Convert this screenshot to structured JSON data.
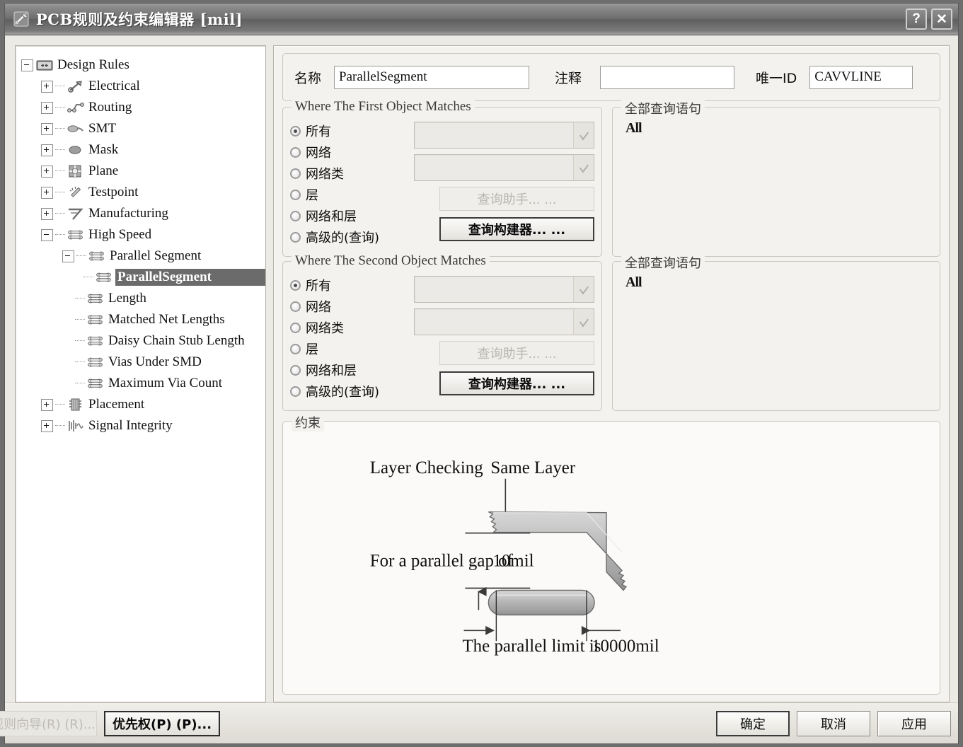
{
  "window": {
    "title": "PCB规则及约束编辑器 [mil]",
    "help_button": "?",
    "close_button": "✕"
  },
  "tree": {
    "root": {
      "label": "Design Rules",
      "icon": "design-rules-icon",
      "expanded": true
    },
    "items": [
      {
        "label": "Electrical",
        "icon": "electrical-icon",
        "expanded": false,
        "depth": 1
      },
      {
        "label": "Routing",
        "icon": "routing-icon",
        "expanded": false,
        "depth": 1
      },
      {
        "label": "SMT",
        "icon": "smt-icon",
        "expanded": false,
        "depth": 1
      },
      {
        "label": "Mask",
        "icon": "mask-icon",
        "expanded": false,
        "depth": 1
      },
      {
        "label": "Plane",
        "icon": "plane-icon",
        "expanded": false,
        "depth": 1
      },
      {
        "label": "Testpoint",
        "icon": "testpoint-icon",
        "expanded": false,
        "depth": 1
      },
      {
        "label": "Manufacturing",
        "icon": "manufacturing-icon",
        "expanded": false,
        "depth": 1
      },
      {
        "label": "High Speed",
        "icon": "highspeed-icon",
        "expanded": true,
        "depth": 1
      },
      {
        "label": "Parallel Segment",
        "icon": "highspeed-icon",
        "expanded": true,
        "depth": 2
      },
      {
        "label": "ParallelSegment",
        "icon": "highspeed-icon",
        "selected": true,
        "depth": 3
      },
      {
        "label": "Length",
        "icon": "highspeed-icon",
        "depth": 2
      },
      {
        "label": "Matched Net Lengths",
        "icon": "highspeed-icon",
        "depth": 2
      },
      {
        "label": "Daisy Chain Stub Length",
        "icon": "highspeed-icon",
        "depth": 2
      },
      {
        "label": "Vias Under SMD",
        "icon": "highspeed-icon",
        "depth": 2
      },
      {
        "label": "Maximum Via Count",
        "icon": "highspeed-icon",
        "depth": 2
      },
      {
        "label": "Placement",
        "icon": "placement-icon",
        "expanded": false,
        "depth": 1
      },
      {
        "label": "Signal Integrity",
        "icon": "signal-integrity-icon",
        "expanded": false,
        "depth": 1
      }
    ]
  },
  "header": {
    "name_label": "名称",
    "name_value": "ParallelSegment",
    "comment_label": "注释",
    "comment_value": "",
    "uid_label": "唯一ID",
    "uid_value": "CAVVLINE"
  },
  "first_object": {
    "title": "Where The First Object Matches",
    "radios": [
      {
        "label": "所有",
        "selected": true
      },
      {
        "label": "网络",
        "selected": false
      },
      {
        "label": "网络类",
        "selected": false
      },
      {
        "label": "层",
        "selected": false
      },
      {
        "label": "网络和层",
        "selected": false
      },
      {
        "label": "高级的(查询)",
        "selected": false
      }
    ],
    "combo1_value": "",
    "combo2_value": "",
    "query_helper_button": "查询助手... ...",
    "query_builder_button": "查询构建器... ..."
  },
  "second_object": {
    "title": "Where The Second Object Matches",
    "radios": [
      {
        "label": "所有",
        "selected": true
      },
      {
        "label": "网络",
        "selected": false
      },
      {
        "label": "网络类",
        "selected": false
      },
      {
        "label": "层",
        "selected": false
      },
      {
        "label": "网络和层",
        "selected": false
      },
      {
        "label": "高级的(查询)",
        "selected": false
      }
    ],
    "combo1_value": "",
    "combo2_value": "",
    "query_helper_button": "查询助手... ...",
    "query_builder_button": "查询构建器... ..."
  },
  "query_panel_first": {
    "title": "全部查询语句",
    "text": "All"
  },
  "query_panel_second": {
    "title": "全部查询语句",
    "text": "All"
  },
  "constraint": {
    "title": "约束",
    "layer_checking_label": "Layer Checking",
    "layer_checking_value": "Same Layer",
    "gap_label": "For a parallel gap of",
    "gap_value": "10mil",
    "limit_label": "The parallel limit is",
    "limit_value": "10000mil"
  },
  "footer": {
    "rule_wizard_button": "规则向导(R) (R)...",
    "priority_button": "优先权(P) (P)...",
    "ok_button": "确定",
    "cancel_button": "取消",
    "apply_button": "应用"
  },
  "colors": {
    "title_bar": "#6e6e6e",
    "selection": "#6b6b6b",
    "panel_bg": "#f4f2ee",
    "tree_bg": "#ffffff",
    "trace_fill": "#b9b9b9"
  }
}
